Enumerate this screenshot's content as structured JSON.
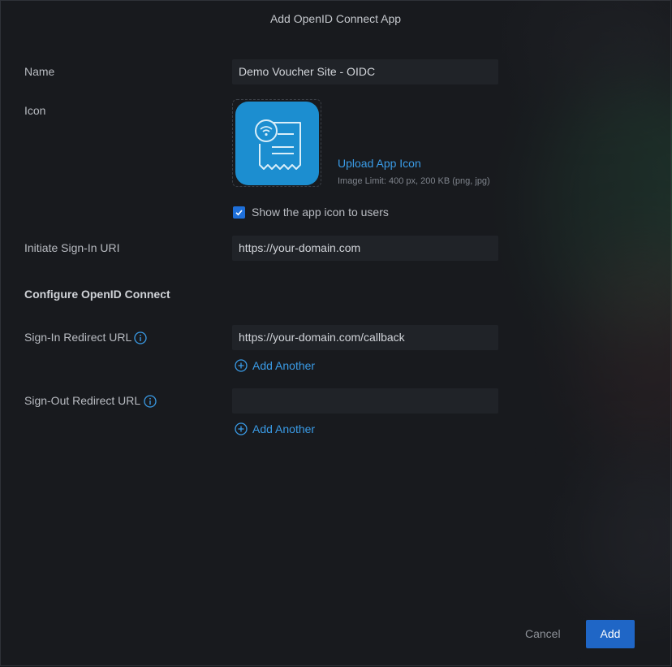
{
  "dialog": {
    "title": "Add OpenID Connect App"
  },
  "form": {
    "name_label": "Name",
    "name_value": "Demo Voucher Site - OIDC",
    "icon_label": "Icon",
    "upload_link": "Upload App Icon",
    "upload_hint": "Image Limit: 400 px, 200 KB (png, jpg)",
    "show_icon_label": "Show the app icon to users",
    "show_icon_checked": true,
    "initiate_label": "Initiate Sign-In URI",
    "initiate_value": "https://your-domain.com",
    "section_heading": "Configure OpenID Connect",
    "signin_label": "Sign-In Redirect URL",
    "signin_value": "https://your-domain.com/callback",
    "signin_add_another": "Add Another",
    "signout_label": "Sign-Out Redirect URL",
    "signout_value": "",
    "signout_add_another": "Add Another"
  },
  "footer": {
    "cancel_label": "Cancel",
    "add_label": "Add"
  },
  "colors": {
    "accent": "#1f66c6",
    "link": "#3a9be6",
    "app_icon_bg": "#1c8ed0"
  },
  "icons": [
    "receipt-wifi-icon",
    "info-icon",
    "plus-circle-icon",
    "checkmark-icon"
  ]
}
